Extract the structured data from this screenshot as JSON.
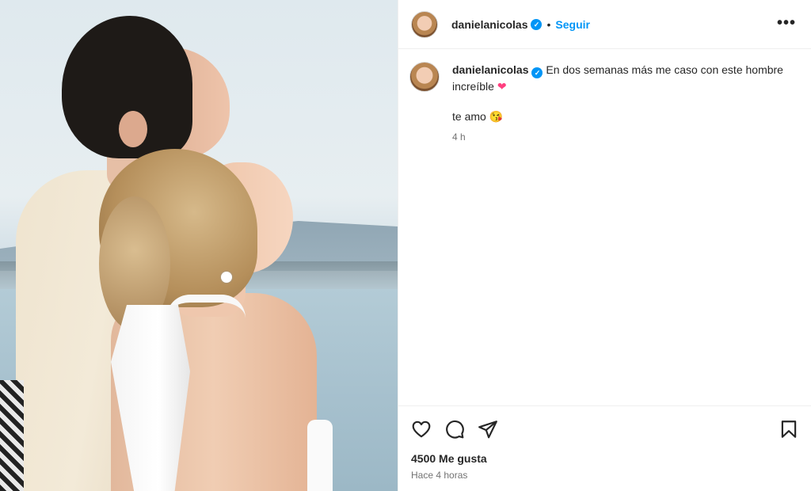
{
  "post": {
    "username": "danielanicolas",
    "follow_label": "Seguir",
    "dot": "•",
    "more_label": "•••",
    "verified_glyph": "✓",
    "caption": "En dos semanas más me caso con este hombre increíble",
    "caption_emoji": "❤",
    "caption_line2": "te amo",
    "caption_line2_emoji": "😘",
    "comment_time": "4 h",
    "likes": "4500 Me gusta",
    "posted_ago": "Hace 4 horas"
  },
  "icons": {
    "like": "heart-icon",
    "comment": "comment-icon",
    "share": "share-icon",
    "save": "bookmark-icon",
    "verified": "verified-icon",
    "more": "more-options-icon"
  },
  "colors": {
    "accent": "#0095f6",
    "text": "#262626",
    "muted": "#737373",
    "divider": "#efefef"
  }
}
